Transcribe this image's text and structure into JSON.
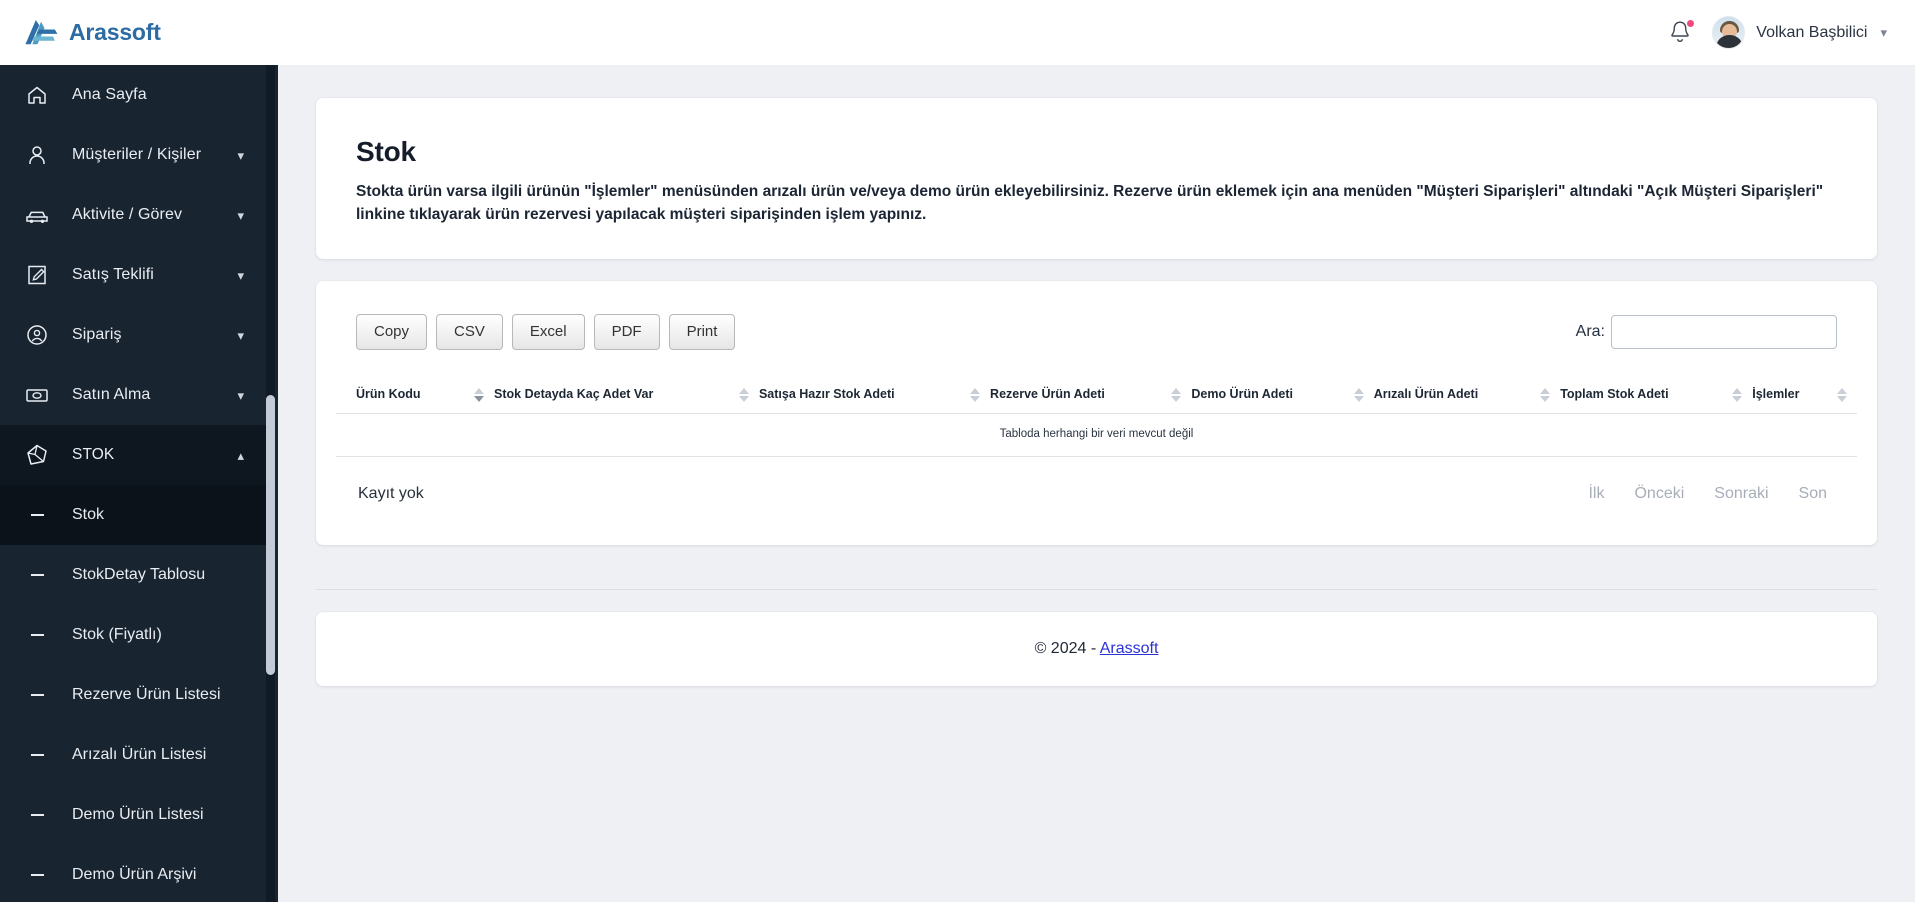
{
  "brand": {
    "name": "Arassoft",
    "logo_icon": "arassoft-logo-icon",
    "accent": "#2c6ca3"
  },
  "topbar": {
    "notifications_icon": "bell-icon",
    "has_unread": true,
    "unread_dot_color": "#ef4a7b",
    "user_name": "Volkan Başbilici",
    "user_avatar_icon": "avatar",
    "user_menu_icon": "chevron-down-icon"
  },
  "sidebar": {
    "background": "#182430",
    "items": [
      {
        "label": "Ana Sayfa",
        "icon": "home-icon",
        "expandable": false,
        "active": false
      },
      {
        "label": "Müşteriler / Kişiler",
        "icon": "user-icon",
        "expandable": true,
        "active": false,
        "chevron": "chevron-down-icon"
      },
      {
        "label": "Aktivite / Görev",
        "icon": "car-icon",
        "expandable": true,
        "active": false,
        "chevron": "chevron-down-icon"
      },
      {
        "label": "Satış Teklifi",
        "icon": "edit-doc-icon",
        "expandable": true,
        "active": false,
        "chevron": "chevron-down-icon"
      },
      {
        "label": "Sipariş",
        "icon": "user-circle-icon",
        "expandable": true,
        "active": false,
        "chevron": "chevron-down-icon"
      },
      {
        "label": "Satın Alma",
        "icon": "money-icon",
        "expandable": true,
        "active": false,
        "chevron": "chevron-down-icon"
      },
      {
        "label": "STOK",
        "icon": "cube-icon",
        "expandable": true,
        "active": true,
        "chevron": "chevron-up-icon"
      }
    ],
    "sub_items": [
      {
        "label": "Stok",
        "active": true
      },
      {
        "label": "StokDetay Tablosu",
        "active": false
      },
      {
        "label": "Stok (Fiyatlı)",
        "active": false
      },
      {
        "label": "Rezerve Ürün Listesi",
        "active": false
      },
      {
        "label": "Arızalı Ürün Listesi",
        "active": false
      },
      {
        "label": "Demo Ürün Listesi",
        "active": false
      },
      {
        "label": "Demo Ürün Arşivi",
        "active": false
      }
    ]
  },
  "page": {
    "title": "Stok",
    "description": "Stokta ürün varsa ilgili ürünün \"İşlemler\" menüsünden arızalı ürün ve/veya demo ürün ekleyebilirsiniz. Rezerve ürün eklemek için ana menüden \"Müşteri Siparişleri\" altındaki \"Açık Müşteri Siparişleri\" linkine tıklayarak ürün rezervesi yapılacak müşteri siparişinden işlem yapınız."
  },
  "table": {
    "export_buttons": [
      "Copy",
      "CSV",
      "Excel",
      "PDF",
      "Print"
    ],
    "search_label": "Ara:",
    "search_value": "",
    "search_placeholder": "",
    "columns": [
      {
        "label": "Ürün Kodu",
        "sort": "desc"
      },
      {
        "label": "Stok Detayda Kaç Adet Var",
        "sort": "none"
      },
      {
        "label": "Satışa Hazır Stok Adeti",
        "sort": "none"
      },
      {
        "label": "Rezerve Ürün Adeti",
        "sort": "none"
      },
      {
        "label": "Demo Ürün Adeti",
        "sort": "none"
      },
      {
        "label": "Arızalı Ürün Adeti",
        "sort": "none"
      },
      {
        "label": "Toplam Stok Adeti",
        "sort": "none"
      },
      {
        "label": "İşlemler",
        "sort": "none"
      }
    ],
    "rows": [],
    "empty_message": "Tabloda herhangi bir veri mevcut değil",
    "record_info": "Kayıt yok",
    "pagination": [
      "İlk",
      "Önceki",
      "Sonraki",
      "Son"
    ]
  },
  "footer": {
    "copyright": "© 2024 - ",
    "link": "Arassoft"
  }
}
